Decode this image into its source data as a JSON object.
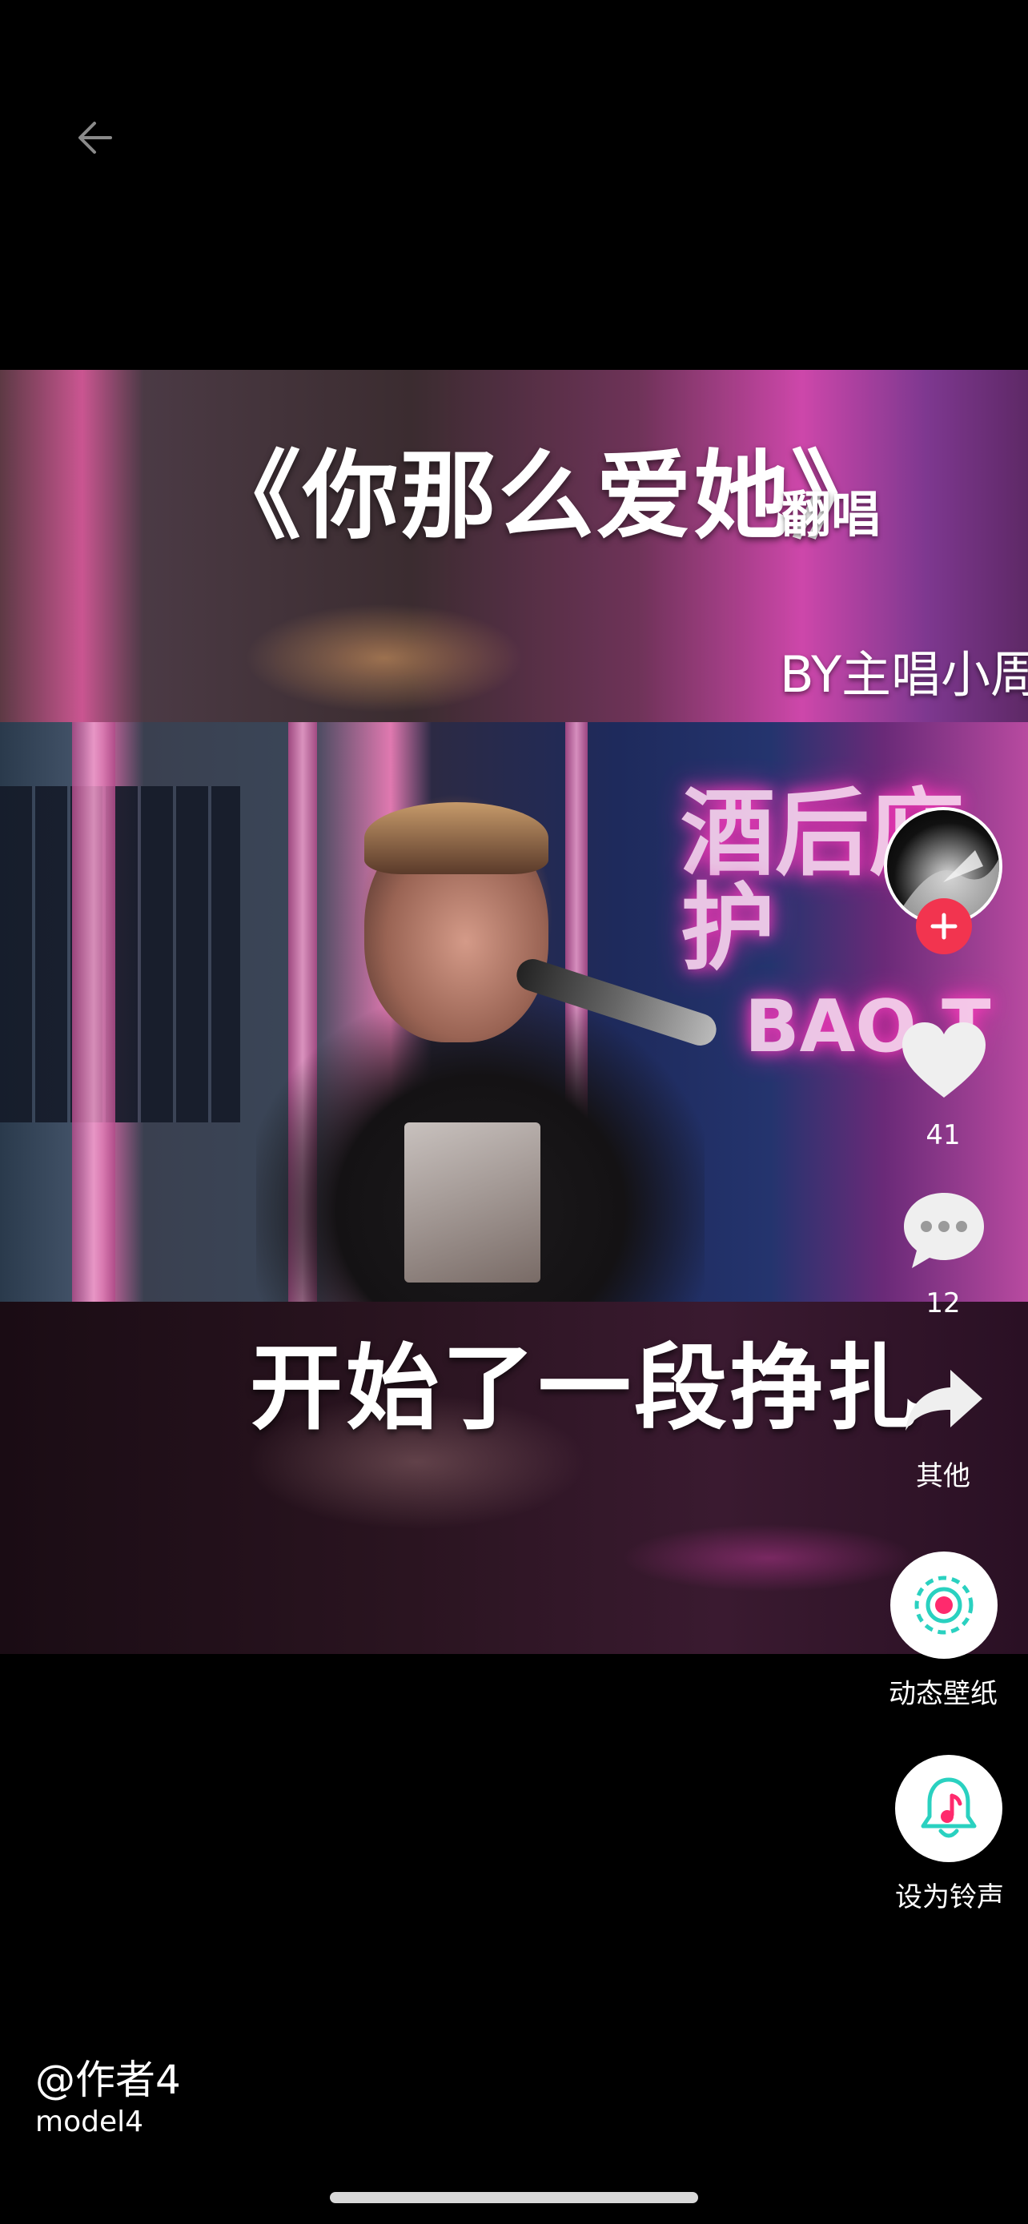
{
  "nav": {
    "back_icon": "arrow-left-icon"
  },
  "video": {
    "title_caption": "《你那么爱她》",
    "title_suffix": "翻唱",
    "byline": "BY主唱小周",
    "neon_sign_text": "酒后庇护",
    "neon_sign_sub": "BAO T",
    "lyric_caption": "开始了一段挣扎"
  },
  "actions": {
    "follow_icon": "plus-icon",
    "like": {
      "icon": "heart-icon",
      "count": "41"
    },
    "comment": {
      "icon": "comment-icon",
      "count": "12"
    },
    "share": {
      "icon": "share-arrow-icon",
      "label": "其他"
    },
    "wallpaper": {
      "icon": "live-wallpaper-icon",
      "label": "动态壁纸"
    },
    "ringtone": {
      "icon": "bell-music-icon",
      "label": "设为铃声"
    }
  },
  "author": {
    "name": "@作者4",
    "description": "model4"
  },
  "colors": {
    "background": "#000000",
    "follow_red": "#f2344f",
    "accent_teal": "#2ad1c0",
    "accent_pink": "#ff2a6d"
  }
}
